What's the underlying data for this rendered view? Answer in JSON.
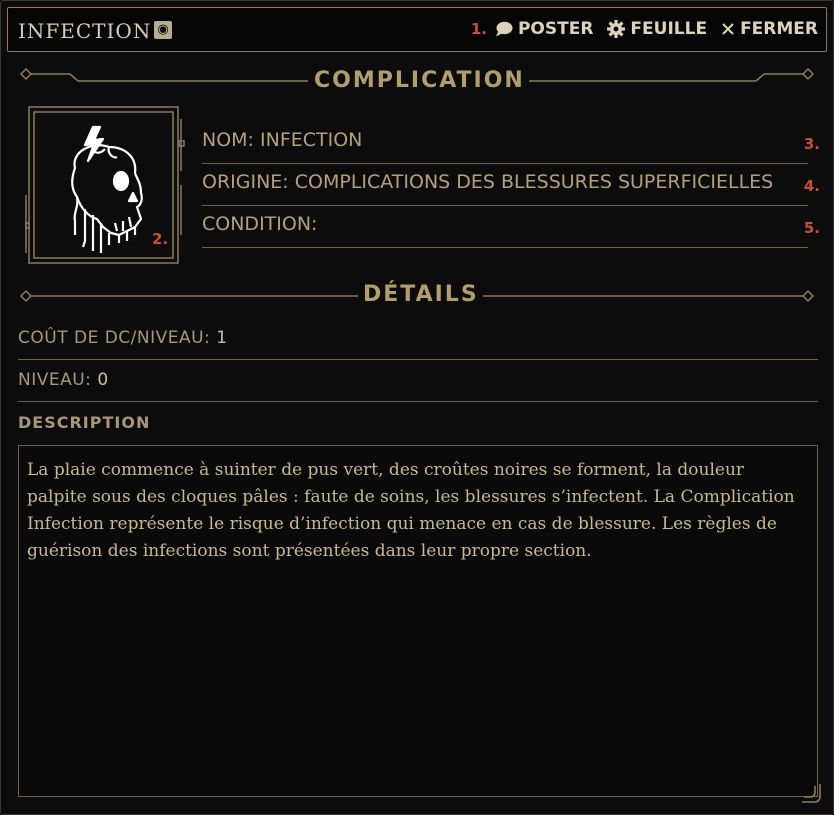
{
  "window": {
    "title": "INFECTION",
    "globe_icon": "globe-icon"
  },
  "header_actions": {
    "marker_1": "1.",
    "post_label": "POSTER",
    "sheet_label": "FEUILLE",
    "close_label": "FERMER"
  },
  "complication": {
    "section_title": "COMPLICATION",
    "portrait_marker": "2.",
    "fields": [
      {
        "text": "NOM: INFECTION",
        "marker": "3."
      },
      {
        "text": "ORIGINE: COMPLICATIONS DES BLESSURES SUPERFICIELLES",
        "marker": "4."
      },
      {
        "text": "CONDITION:",
        "marker": "5."
      }
    ]
  },
  "details": {
    "section_title": "DÉTAILS",
    "cost_label": "COÛT DE DC/NIVEAU:",
    "cost_value": "1",
    "level_label": "NIVEAU:",
    "level_value": "0",
    "description_label": "DESCRIPTION",
    "description_text": "La plaie commence à suinter de pus vert, des croûtes noires se forment, la douleur palpite sous des cloques pâles : faute de soins, les blessures s’infectent. La Complication Infection représente le risque d’infection qui menace en cas de blessure. Les règles de guérison des infections sont présentées dans leur propre section."
  },
  "colors": {
    "gold": "#b29d6c",
    "marker": "#c8502c",
    "background": "#0c0c0c"
  }
}
